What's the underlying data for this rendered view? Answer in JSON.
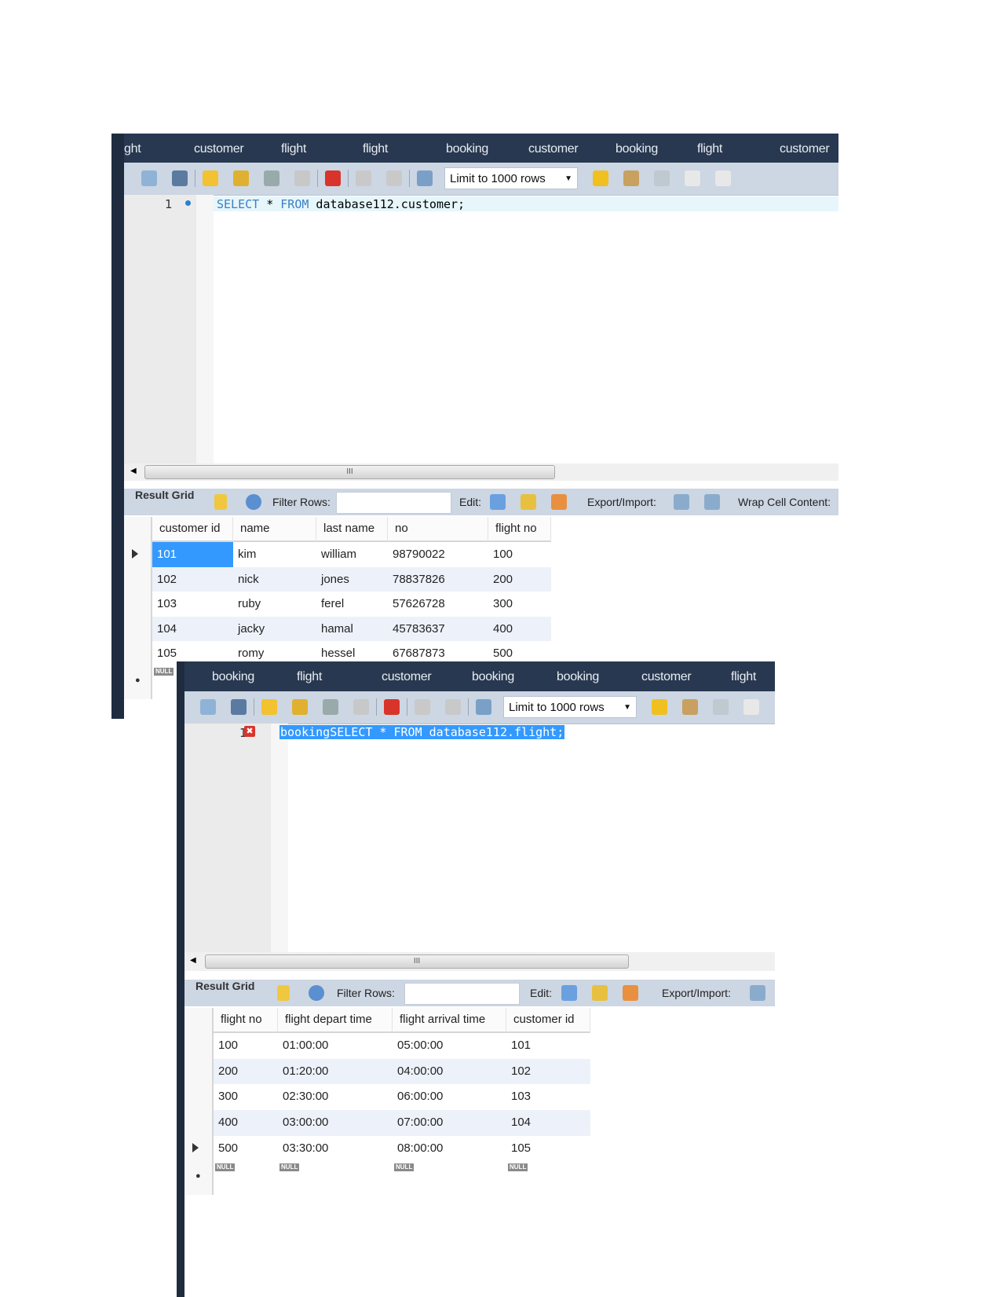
{
  "panel1": {
    "tabs": [
      "ght",
      "customer",
      "flight",
      "flight",
      "booking",
      "customer",
      "booking",
      "flight",
      "customer"
    ],
    "limit_select": "Limit to 1000 rows",
    "line_number": "1",
    "sql_keyword1": "SELECT",
    "sql_star": " * ",
    "sql_keyword2": "FROM",
    "sql_rest": " database112.customer;",
    "scroll_grip": "III",
    "result_toolbar": {
      "result_grid": "Result Grid",
      "filter_rows": "Filter Rows:",
      "edit": "Edit:",
      "export_import": "Export/Import:",
      "wrap": "Wrap Cell Content:"
    },
    "columns": [
      "customer id",
      "name",
      "last name",
      "no",
      "flight no"
    ],
    "rows": [
      [
        "101",
        "kim",
        "william",
        "98790022",
        "100"
      ],
      [
        "102",
        "nick",
        "jones",
        "78837826",
        "200"
      ],
      [
        "103",
        "ruby",
        "ferel",
        "57626728",
        "300"
      ],
      [
        "104",
        "jacky",
        "hamal",
        "45783637",
        "400"
      ],
      [
        "105",
        "romy",
        "hessel",
        "67687873",
        "500"
      ]
    ],
    "null_label": "NULL"
  },
  "panel2": {
    "tabs": [
      "booking",
      "flight",
      "customer",
      "booking",
      "booking",
      "customer",
      "flight"
    ],
    "limit_select": "Limit to 1000 rows",
    "line_number": "1",
    "sql_text": "bookingSELECT * FROM database112.flight;",
    "scroll_grip": "III",
    "result_toolbar": {
      "result_grid": "Result Grid",
      "filter_rows": "Filter Rows:",
      "edit": "Edit:",
      "export_import": "Export/Import:"
    },
    "columns": [
      "flight no",
      "flight depart time",
      "flight arrival time",
      "customer id"
    ],
    "rows": [
      [
        "100",
        "01:00:00",
        "05:00:00",
        "101"
      ],
      [
        "200",
        "01:20:00",
        "04:00:00",
        "102"
      ],
      [
        "300",
        "02:30:00",
        "06:00:00",
        "103"
      ],
      [
        "400",
        "03:00:00",
        "07:00:00",
        "104"
      ],
      [
        "500",
        "03:30:00",
        "08:00:00",
        "105"
      ]
    ],
    "null_label": "NULL"
  },
  "colors": {
    "tabbar": "#283850",
    "toolbar": "#cdd6e3",
    "selection": "#3399ff",
    "error": "#d9342b"
  }
}
